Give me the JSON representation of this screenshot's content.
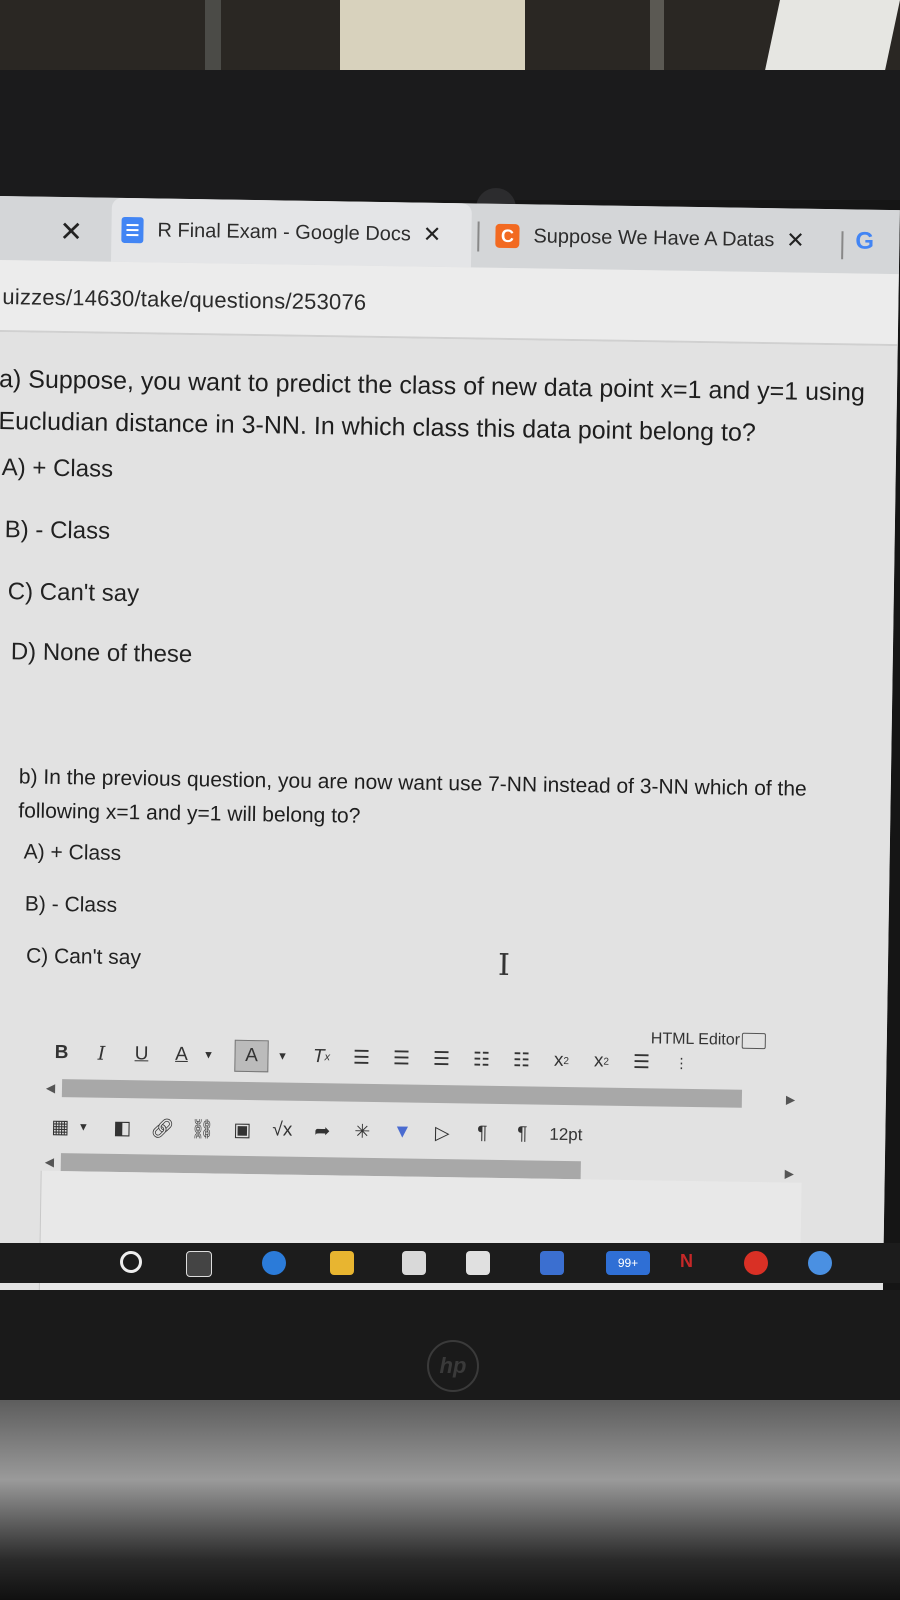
{
  "browser": {
    "close_glyph": "✕",
    "tabs": [
      {
        "title": "R Final Exam - Google Docs",
        "close": "✕",
        "active": true
      },
      {
        "title": "Suppose We Have A Datas",
        "close": "✕",
        "active": false
      }
    ],
    "third_tab_favicon": "G",
    "url": "uizzes/14630/take/questions/253076"
  },
  "question_a": {
    "text": "a) Suppose, you want to predict the class of new data point x=1 and y=1 using Eucludian distance in 3-NN. In which class this data point belong to?",
    "options": [
      "A) + Class",
      "B) - Class",
      "C) Can't say",
      "D) None of these"
    ]
  },
  "question_b": {
    "text": "b) In the previous question, you are now want use 7-NN instead of 3-NN which of the following x=1 and y=1 will belong to?",
    "options": [
      "A) + Class",
      "B) - Class",
      "C) Can't say"
    ]
  },
  "editor": {
    "label": "HTML Editor",
    "font_size": "12pt",
    "toolbar_row1": [
      "B",
      "I",
      "U",
      "A",
      "A",
      "Tx",
      "align-left-icon",
      "align-center-icon",
      "align-right-icon",
      "indent-icon",
      "outdent-icon",
      "superscript-icon",
      "subscript-icon",
      "list-icon"
    ],
    "toolbar_row2": [
      "table-icon",
      "media-icon",
      "link-icon",
      "unlink-icon",
      "image-icon",
      "equation-icon",
      "embed-icon",
      "sparkle-icon",
      "checkmark-icon",
      "video-icon",
      "ltr-icon",
      "rtl-icon"
    ]
  },
  "taskbar": {
    "badge": "99+"
  },
  "colors": {
    "docs_blue": "#4285f4",
    "chegg_orange": "#f26a21",
    "background": "#e2e2e2"
  }
}
